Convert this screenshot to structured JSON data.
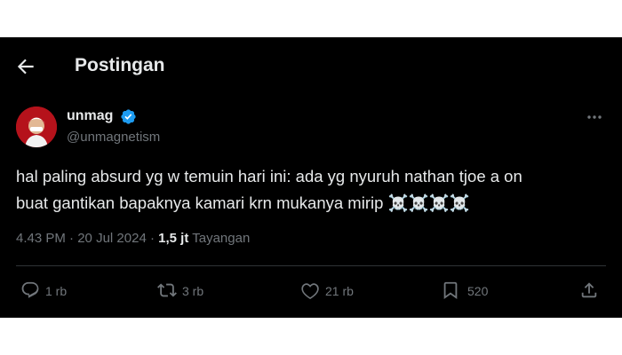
{
  "header": {
    "title": "Postingan"
  },
  "author": {
    "name": "unmag",
    "handle": "@unmagnetism"
  },
  "tweet": {
    "text_line1": "hal paling absurd yg w temuin hari ini: ada yg nyuruh nathan tjoe a on",
    "text_line2": "buat gantikan bapaknya kamari krn mukanya mirip ☠️☠️☠️☠️",
    "time": "4.43 PM",
    "date": "20 Jul 2024",
    "views_count": "1,5 jt",
    "views_label": "Tayangan"
  },
  "actions": {
    "reply": "1 rb",
    "repost": "3 rb",
    "like": "21 rb",
    "bookmark": "520"
  },
  "colors": {
    "background": "#000000",
    "text": "#e7e9ea",
    "secondary": "#71767b",
    "verified": "#1d9bf0",
    "divider": "#2f3336"
  }
}
